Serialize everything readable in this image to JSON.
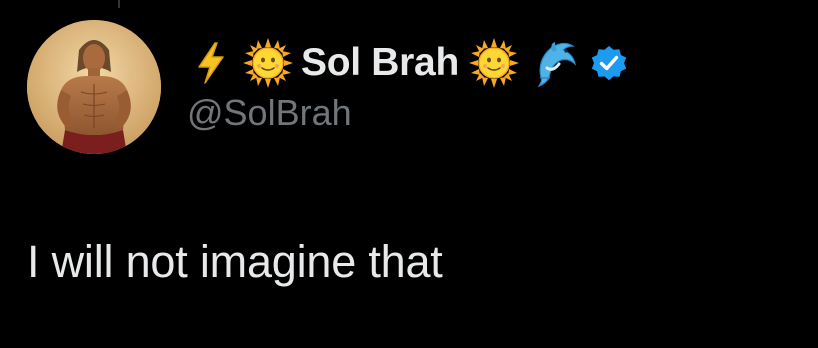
{
  "tweet": {
    "author": {
      "prefix_emojis": [
        "lightning-emoji",
        "sun-with-face-emoji"
      ],
      "display_name": "Sol Brah",
      "suffix_emojis": [
        "sun-with-face-emoji",
        "dolphin-emoji"
      ],
      "verified": true,
      "verified_color": "#1d9bf0",
      "handle": "@SolBrah",
      "avatar": "avatar-photo"
    },
    "text": "I will not imagine that"
  },
  "colors": {
    "background": "#000000",
    "primary_text": "#e7e9ea",
    "secondary_text": "#71767b",
    "accent": "#1d9bf0"
  }
}
